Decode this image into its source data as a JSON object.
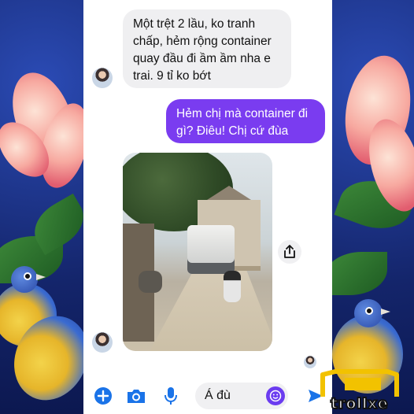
{
  "messages": [
    {
      "direction": "incoming",
      "text": "Một trệt 2 lầu, ko tranh chấp, hẻm rộng container quay đầu đi ầm ầm nha e trai. 9 tỉ ko bớt"
    },
    {
      "direction": "outgoing",
      "text": "Hẻm chị mà container đi gì? Điêu! Chị cứ đùa"
    }
  ],
  "incoming_lines": [
    "Một trệt 2 lầu, ko tranh",
    "chấp, hẻm rộng container",
    "quay đầu đi ầm ầm nha e",
    "trai. 9 tỉ ko bớt"
  ],
  "outgoing_lines": [
    "Hẻm chị mà container đi",
    "gì? Điêu! Chị cứ đùa"
  ],
  "attachment": {
    "type": "photo",
    "subject": "truck-in-alley-photo"
  },
  "composer": {
    "input_value": "Á đù",
    "icons": [
      "plus-icon",
      "camera-icon",
      "microphone-icon",
      "emoji-icon",
      "send-icon"
    ]
  },
  "watermark": {
    "text": "trollxe"
  },
  "colors": {
    "outgoing_bubble": "#7a3cf0",
    "incoming_bubble": "#efeff1",
    "accent": "#1a73e8",
    "side_background": "#14256b"
  }
}
